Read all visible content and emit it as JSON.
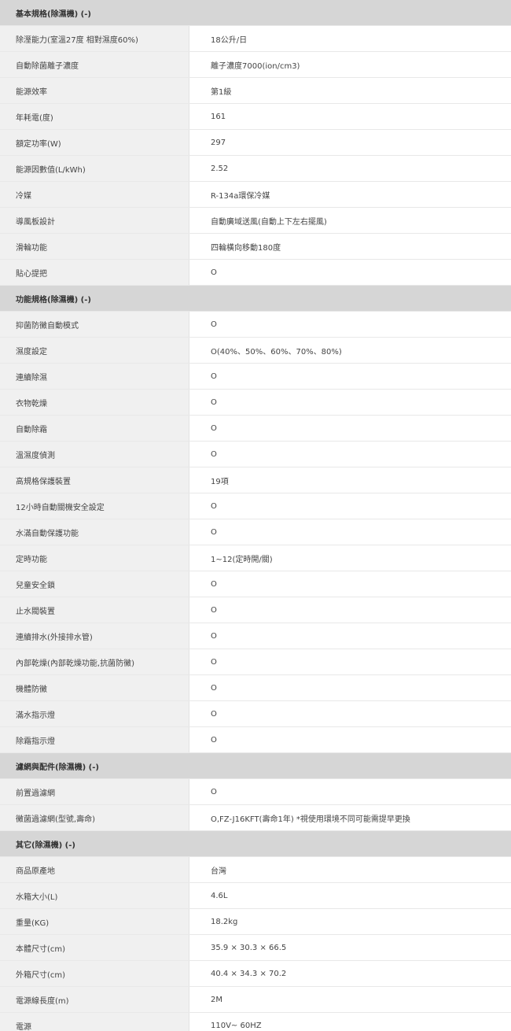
{
  "sections": [
    {
      "title": "基本規格(除濕機) (-)",
      "rows": [
        {
          "label": "除溼能力(室溫27度 相對濕度60%)",
          "value": "18公升/日"
        },
        {
          "label": "自動除菌離子濃度",
          "value": "離子濃度7000(ion/cm3)"
        },
        {
          "label": "能源效率",
          "value": "第1級"
        },
        {
          "label": "年耗電(度)",
          "value": "161"
        },
        {
          "label": "額定功率(W)",
          "value": "297"
        },
        {
          "label": "能源因數值(L/kWh)",
          "value": "2.52"
        },
        {
          "label": "冷媒",
          "value": "R-134a環保冷媒"
        },
        {
          "label": "導風板設計",
          "value": "自動廣域送風(自動上下左右擺風)"
        },
        {
          "label": "滑輪功能",
          "value": "四輪橫向移動180度"
        },
        {
          "label": "貼心提把",
          "value": "O"
        }
      ]
    },
    {
      "title": "功能規格(除濕機) (-)",
      "rows": [
        {
          "label": "抑菌防黴自動模式",
          "value": "O"
        },
        {
          "label": "濕度設定",
          "value": "O(40%、50%、60%、70%、80%)"
        },
        {
          "label": "連續除濕",
          "value": "O"
        },
        {
          "label": "衣物乾燥",
          "value": "O"
        },
        {
          "label": "自動除霜",
          "value": "O"
        },
        {
          "label": "溫濕度偵測",
          "value": "O"
        },
        {
          "label": "高規格保護裝置",
          "value": "19項"
        },
        {
          "label": "12小時自動關機安全設定",
          "value": "O"
        },
        {
          "label": "水滿自動保護功能",
          "value": "O"
        },
        {
          "label": "定時功能",
          "value": "1~12(定時開/關)"
        },
        {
          "label": "兒童安全鎖",
          "value": "O"
        },
        {
          "label": "止水閥裝置",
          "value": "O"
        },
        {
          "label": "連續排水(外接排水管)",
          "value": "O"
        },
        {
          "label": "內部乾燥(內部乾燥功能,抗菌防黴)",
          "value": "O"
        },
        {
          "label": "機體防黴",
          "value": "O"
        },
        {
          "label": "滿水指示燈",
          "value": "O"
        },
        {
          "label": "除霜指示燈",
          "value": "O"
        }
      ]
    },
    {
      "title": "濾網與配件(除濕機) (-)",
      "rows": [
        {
          "label": "前置過濾網",
          "value": "O"
        },
        {
          "label": "黴菌過濾網(型號,壽命)",
          "value": "O,FZ-J16KFT(壽命1年) *視使用環境不同可能需提早更換"
        }
      ]
    },
    {
      "title": "其它(除濕機) (-)",
      "rows": [
        {
          "label": "商品原產地",
          "value": "台灣"
        },
        {
          "label": "水箱大小(L)",
          "value": "4.6L"
        },
        {
          "label": "重量(KG)",
          "value": "18.2kg"
        },
        {
          "label": "本體尺寸(cm)",
          "value": "35.9 × 30.3 × 66.5"
        },
        {
          "label": "外箱尺寸(cm)",
          "value": "40.4 × 34.3 × 70.2"
        },
        {
          "label": "電源線長度(m)",
          "value": "2M"
        },
        {
          "label": "電源",
          "value": "110V~ 60HZ"
        }
      ]
    }
  ]
}
